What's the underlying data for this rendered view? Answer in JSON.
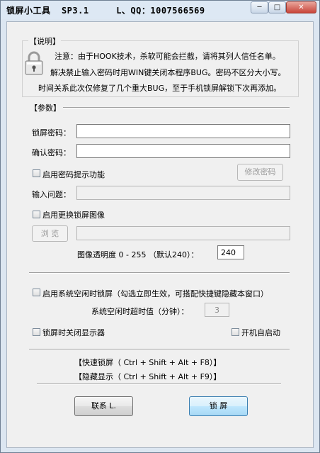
{
  "window": {
    "title": "锁屏小工具  SP3.1     L、QQ：1007566569",
    "minimize_glyph": "─",
    "maximize_glyph": "□",
    "close_glyph": "✕"
  },
  "info": {
    "header": "【说明】",
    "line1": "注意：由于HOOK技术，杀软可能会拦截，请将其列人信任名单。",
    "line2": "解决禁止输入密码时用WIN键关闭本程序BUG。密码不区分大小写。",
    "line3": "时间关系此次仅修复了几个重大BUG，至于手机锁屏解锁下次再添加。",
    "icon": "padlock-icon"
  },
  "params": {
    "header": "【参数】",
    "lock_password_label": "锁屏密码：",
    "lock_password_value": "",
    "confirm_password_label": "确认密码：",
    "confirm_password_value": "",
    "enable_hint_label": "启用密码提示功能",
    "change_password_button": "修改密码",
    "question_label": "输入问题：",
    "question_value": "",
    "enable_image_label": "启用更换锁屏图像",
    "browse_button": "浏 览",
    "image_path_value": "",
    "transparency_label": "图像透明度 0 - 255 （默认240）：",
    "transparency_value": "240",
    "idle_lock_label": "启用系统空闲时锁屏（勾选立即生效，可搭配快捷键隐藏本窗口）",
    "idle_timeout_label": "系统空闲时超时值（分钟）：",
    "idle_timeout_value": "3",
    "close_monitor_label": "锁屏时关闭显示器",
    "autostart_label": "开机自启动"
  },
  "hotkeys": {
    "quick_lock": "【快速锁屏（ Ctrl + Shift + Alt + F8）】",
    "hide_show": "【隐藏显示（ Ctrl + Shift + Alt + F9）】"
  },
  "buttons": {
    "contact": "联系 L.",
    "lock": "锁 屏"
  }
}
